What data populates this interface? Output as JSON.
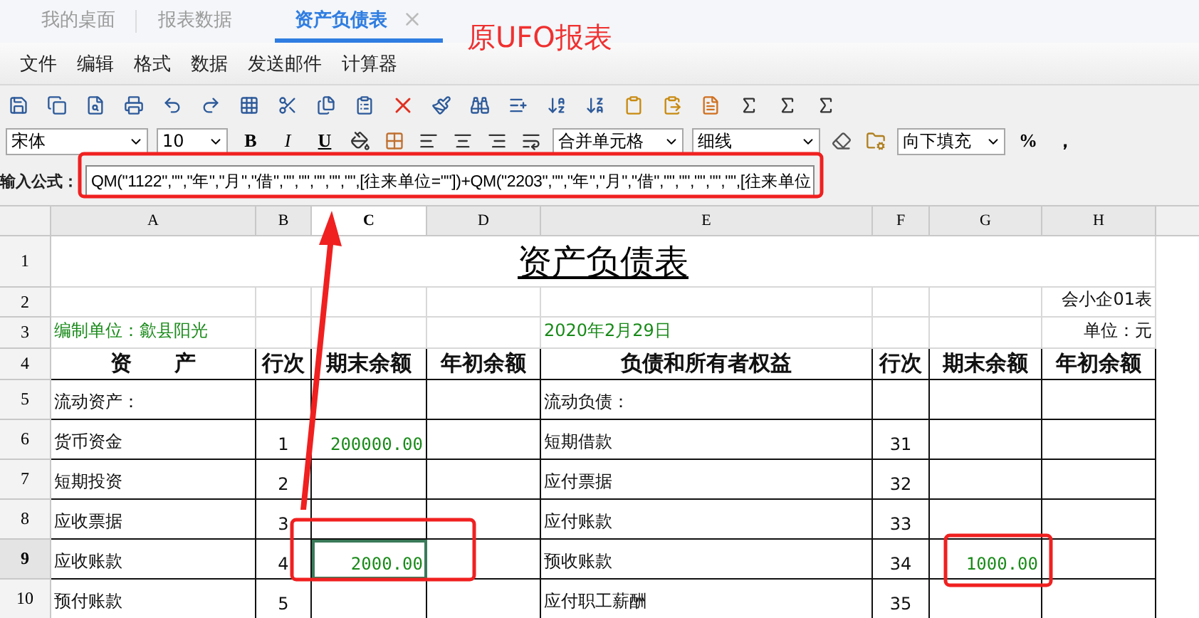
{
  "tabs": [
    {
      "label": "我的桌面",
      "selected": false
    },
    {
      "label": "报表数据",
      "selected": false
    },
    {
      "label": "资产负债表",
      "selected": true
    }
  ],
  "annotation_label": "原UFO报表",
  "menu": [
    "文件",
    "编辑",
    "格式",
    "数据",
    "发送邮件",
    "计算器"
  ],
  "format_bar": {
    "font": "宋体",
    "size": "10",
    "styles": [
      "B",
      "I",
      "U"
    ],
    "merge": "合并单元格",
    "line": "细线",
    "fill": "向下填充",
    "extras": [
      "%",
      "，"
    ]
  },
  "formula": {
    "label": "输入公式：",
    "value": "QM(\"1122\",\"\",\"年\",\"月\",\"借\",\"\",\"\",\"\",\"\",\"\",[往来单位=\"\"])+QM(\"2203\",\"\",\"年\",\"月\",\"借\",\"\",\"\",\"\",\"\",\"\",[往来单位"
  },
  "sheet": {
    "columns": [
      {
        "label": "A",
        "selected": false
      },
      {
        "label": "B",
        "selected": false
      },
      {
        "label": "C",
        "selected": true
      },
      {
        "label": "D",
        "selected": false
      },
      {
        "label": "E",
        "selected": false
      },
      {
        "label": "F",
        "selected": false
      },
      {
        "label": "G",
        "selected": false
      },
      {
        "label": "H",
        "selected": false
      }
    ],
    "rows": [
      {
        "number": "1",
        "selected": false,
        "kind": "title",
        "text": "资产负债表"
      },
      {
        "number": "2",
        "selected": false,
        "kind": "note",
        "right": "会小企01表"
      },
      {
        "number": "3",
        "selected": false,
        "kind": "info",
        "left": "编制单位：歙县阳光",
        "center": "2020年2月29日",
        "right": "单位：元"
      },
      {
        "number": "4",
        "selected": false,
        "kind": "header",
        "cells": [
          "资　　产",
          "行次",
          "期末余额",
          "年初余额",
          "负债和所有者权益",
          "行次",
          "期末余额",
          "年初余额"
        ]
      },
      {
        "number": "5",
        "selected": false,
        "kind": "data",
        "cells": [
          "流动资产：",
          null,
          null,
          null,
          "流动负债：",
          null,
          null,
          null
        ]
      },
      {
        "number": "6",
        "selected": false,
        "kind": "data",
        "cells": [
          "货币资金",
          "1",
          "200000.00",
          null,
          "短期借款",
          "31",
          null,
          null
        ]
      },
      {
        "number": "7",
        "selected": false,
        "kind": "data",
        "cells": [
          "短期投资",
          "2",
          null,
          null,
          "应付票据",
          "32",
          null,
          null
        ]
      },
      {
        "number": "8",
        "selected": false,
        "kind": "data",
        "cells": [
          "应收票据",
          "3",
          null,
          null,
          "应付账款",
          "33",
          null,
          null
        ]
      },
      {
        "number": "9",
        "selected": true,
        "kind": "data",
        "cells": [
          "应收账款",
          "4",
          {
            "text": "2000.00",
            "active": true
          },
          null,
          "预收账款",
          "34",
          "1000.00",
          null
        ]
      },
      {
        "number": "10",
        "selected": false,
        "kind": "data",
        "cells": [
          "预付账款",
          "5",
          null,
          null,
          "应付职工薪酬",
          "35",
          null,
          null
        ]
      }
    ]
  }
}
